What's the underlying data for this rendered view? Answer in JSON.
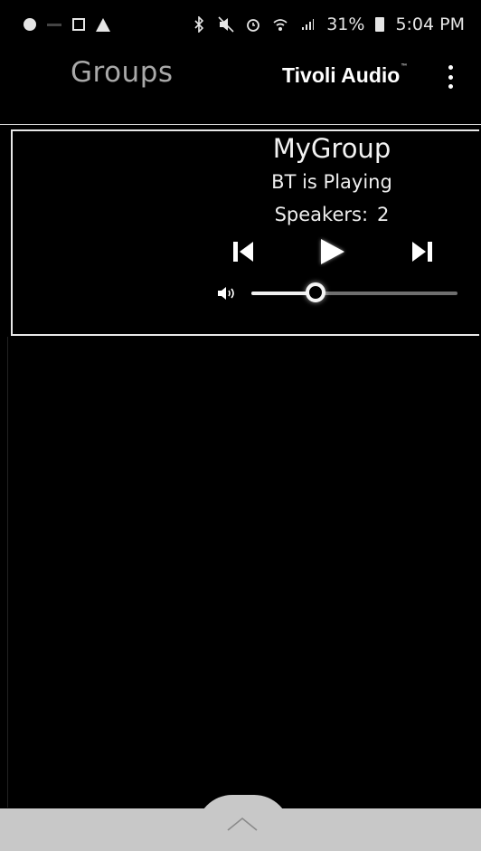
{
  "status_bar": {
    "battery_percent": "31%",
    "time": "5:04 PM",
    "left_icons": [
      "notification-dot-icon",
      "app-icon",
      "gallery-icon",
      "warning-icon"
    ],
    "right_icons": [
      "bluetooth-icon",
      "mute-icon",
      "alarm-icon",
      "wifi-icon",
      "signal-icon",
      "battery-icon"
    ]
  },
  "app_bar": {
    "title": "Groups",
    "brand": "Tivoli Audio",
    "brand_mark": "™",
    "menu_icon": "overflow-menu-icon"
  },
  "group": {
    "name": "MyGroup",
    "status": "BT is Playing",
    "speakers_label": "Speakers:",
    "speakers_count": "2",
    "volume": 0.31,
    "controls": [
      "previous-icon",
      "play-icon",
      "next-icon"
    ]
  },
  "bottom_bar": {
    "icon": "chevron-up-icon"
  },
  "colors": {
    "background": "#000000",
    "text": "#ffffff",
    "muted_title": "#a9a9a9",
    "bottom_bar": "#c8c8c8"
  }
}
